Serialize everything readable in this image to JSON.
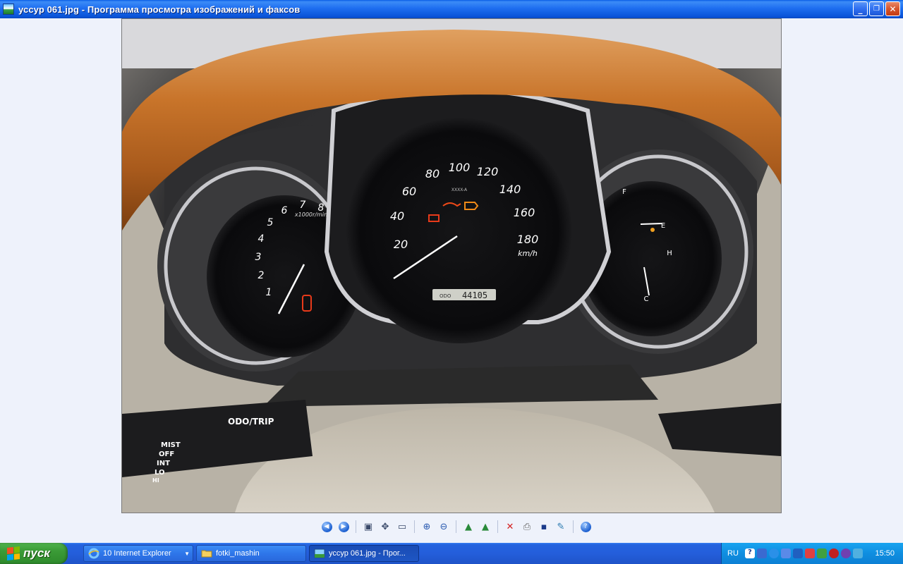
{
  "window": {
    "title": "уссур 061.jpg - Программа просмотра изображений и факсов",
    "minimize_label": "_",
    "maximize_label": "❐",
    "close_label": "✕"
  },
  "image": {
    "description_hidden": "",
    "speedometer_labels": [
      "20",
      "40",
      "60",
      "80",
      "100",
      "120",
      "140",
      "160",
      "180"
    ],
    "speed_unit": "km/h",
    "odometer_label": "ODO",
    "odometer_value": "44105",
    "tach_labels": [
      "1",
      "2",
      "3",
      "4",
      "5",
      "6",
      "7",
      "8"
    ],
    "tach_unit": "x1000r/min",
    "fuel_full": "F",
    "fuel_empty": "E",
    "temp_hot": "H",
    "temp_cold": "C",
    "stalk_odo": "ODO/TRIP",
    "stalk_modes": [
      "MIST",
      "OFF",
      "INT",
      "LO",
      "HI"
    ],
    "small_text": "XXXX-A"
  },
  "toolbar": {
    "icons": [
      "prev-image-icon",
      "next-image-icon",
      "best-fit-icon",
      "actual-size-icon",
      "slideshow-icon",
      "zoom-in-icon",
      "zoom-out-icon",
      "rotate-clockwise-icon",
      "rotate-counterclockwise-icon",
      "delete-icon",
      "print-icon",
      "save-icon",
      "edit-icon",
      "help-icon"
    ]
  },
  "taskbar": {
    "start_label": "пуск",
    "tasks": [
      {
        "label": "10 Internet Explorer",
        "icon": "internet-explorer-icon"
      },
      {
        "label": "fotki_mashin",
        "icon": "folder-icon"
      },
      {
        "label": "уссур 061.jpg - Прог...",
        "icon": "image-viewer-icon"
      }
    ],
    "language": "RU",
    "clock": "15:50"
  }
}
